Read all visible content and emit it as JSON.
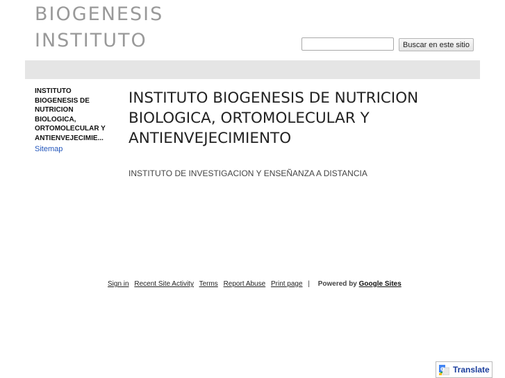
{
  "header": {
    "site_title_line1": "BIOGENESIS",
    "site_title_line2": "INSTITUTO",
    "search_placeholder": "",
    "search_button_label": "Buscar en este sitio"
  },
  "sidebar": {
    "home_link_lines": [
      "INSTITUTO",
      "BIOGENESIS DE",
      "NUTRICION",
      "BIOLOGICA,",
      "ORTOMOLECULAR Y",
      "ANTIENVEJECIMIE..."
    ],
    "sitemap_label": "Sitemap"
  },
  "main": {
    "heading_lines": [
      "INSTITUTO BIOGENESIS DE NUTRICION",
      "BIOLOGICA, ORTOMOLECULAR Y",
      "ANTIENVEJECIMIENTO"
    ],
    "subtitle": "INSTITUTO DE INVESTIGACION Y ENSEÑANZA A DISTANCIA"
  },
  "footer": {
    "sign_in": "Sign in",
    "recent_activity": "Recent Site Activity",
    "terms": "Terms",
    "report_abuse": "Report Abuse",
    "print_page": "Print page",
    "separator": "|",
    "powered_by": "Powered by",
    "google_sites": "Google Sites"
  },
  "translate": {
    "label": "Translate"
  },
  "colors": {
    "title_gray": "#999999",
    "header_bar": "#e5e5e5",
    "link_blue": "#2255bb",
    "translate_blue": "#1a3d9c"
  }
}
